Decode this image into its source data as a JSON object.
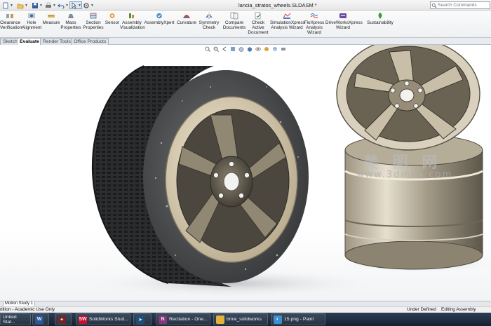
{
  "window": {
    "title": "lancia_stratos_wheels.SLDASM *"
  },
  "search": {
    "placeholder": "Search Commands"
  },
  "quick_access": [
    {
      "name": "new-icon"
    },
    {
      "name": "open-icon"
    },
    {
      "name": "save-icon"
    },
    {
      "name": "print-icon"
    },
    {
      "name": "undo-icon"
    },
    {
      "name": "select-icon"
    },
    {
      "name": "options-icon"
    }
  ],
  "ribbon": {
    "tools": [
      {
        "label": "Clearance\nVerification",
        "icon": "clearance-verification-icon"
      },
      {
        "label": "Hole\nAlignment",
        "icon": "hole-alignment-icon"
      },
      {
        "label": "Measure",
        "icon": "measure-icon"
      },
      {
        "label": "Mass\nProperties",
        "icon": "mass-properties-icon"
      },
      {
        "label": "Section\nProperties",
        "icon": "section-properties-icon"
      },
      {
        "label": "Sensor",
        "icon": "sensor-icon"
      },
      {
        "label": "Assembly\nVisualization",
        "icon": "assembly-visualization-icon"
      },
      {
        "label": "AssemblyXpert",
        "icon": "assemblyxpert-icon"
      },
      {
        "label": "Curvature",
        "icon": "curvature-icon"
      },
      {
        "label": "Symmetry\nCheck",
        "icon": "symmetry-check-icon"
      },
      {
        "label": "Compare\nDocuments",
        "icon": "compare-documents-icon"
      },
      {
        "label": "Check\nActive\nDocument",
        "icon": "check-active-document-icon"
      },
      {
        "label": "SimulationXpress\nAnalysis Wizard",
        "icon": "simulationxpress-icon"
      },
      {
        "label": "FloXpress\nAnalysis\nWizard",
        "icon": "floxpress-icon"
      },
      {
        "label": "DriveWorksXpress\nWizard",
        "icon": "driveworksxpress-icon"
      },
      {
        "label": "Sustainability",
        "icon": "sustainability-icon"
      }
    ]
  },
  "tabs": [
    {
      "label": "Sketch",
      "active": false
    },
    {
      "label": "Evaluate",
      "active": true
    },
    {
      "label": "Render Tools",
      "active": false
    },
    {
      "label": "Office Products",
      "active": false
    }
  ],
  "viewport": {
    "watermark_logo": "美 图 网",
    "watermark_text": "www.3dmox.com"
  },
  "motion_study": {
    "label": "Motion Study 1"
  },
  "status": {
    "left": "dition - Academic Use Only",
    "middle": "Under Defined",
    "right": "Editing Assembly"
  },
  "taskbar": [
    {
      "label": "United Stat...",
      "icon": "start-icon",
      "color": "#3a6ea5"
    },
    {
      "label": "",
      "icon": "word-icon",
      "color": "#2b5797"
    },
    {
      "label": "",
      "icon": "app-icon",
      "color": "#6a2a2a"
    },
    {
      "label": "SolidWorks Stud...",
      "icon": "solidworks-icon",
      "color": "#c8102e"
    },
    {
      "label": "",
      "icon": "media-icon",
      "color": "#1f4f7a"
    },
    {
      "label": "Recitation - One...",
      "icon": "onenote-icon",
      "color": "#80397b"
    },
    {
      "label": "bmw_solidworks",
      "icon": "folder-icon",
      "color": "#e2b33c"
    },
    {
      "label": "15.png - Paint",
      "icon": "paint-icon",
      "color": "#3d8fd1"
    }
  ]
}
